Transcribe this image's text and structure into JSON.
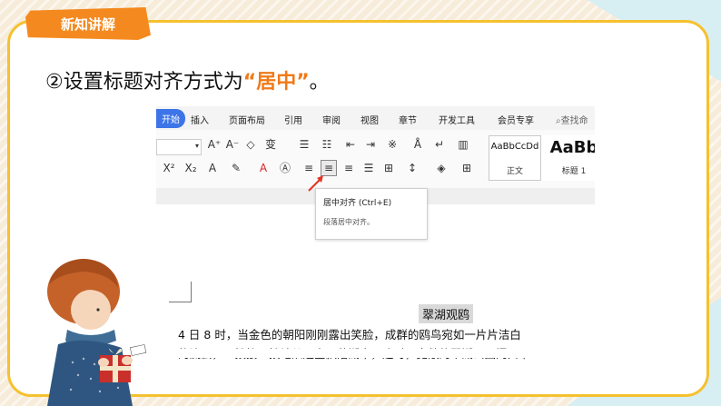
{
  "badge": "新知讲解",
  "heading": {
    "prefix": "②设置标题对齐方式为",
    "highlight": "“居中”",
    "suffix": "。"
  },
  "menu_tabs": [
    "开始",
    "插入",
    "页面布局",
    "引用",
    "审阅",
    "视图",
    "章节",
    "开发工具",
    "会员专享",
    "查找命"
  ],
  "styles": [
    {
      "sample": "AaBbCcDd",
      "name": "正文"
    },
    {
      "sample": "AaBb",
      "name": "标题 1"
    }
  ],
  "tooltip": {
    "title": "居中对齐 (Ctrl+E)",
    "desc": "段落居中对齐。"
  },
  "doc": {
    "title": "翠湖观鸥",
    "line1": "4 日 8 时，当金色的朝阳刚刚露出笑脸，成群的鸥鸟宛如一片片洁白",
    "line2": "的流云，一拨接一拨地从远空飘落湖中，这时，宽敞的翠湖公园门口早"
  },
  "colors": {
    "accent": "#f48a1f",
    "frame": "#f5c12f",
    "tab_active": "#3d74e8"
  }
}
